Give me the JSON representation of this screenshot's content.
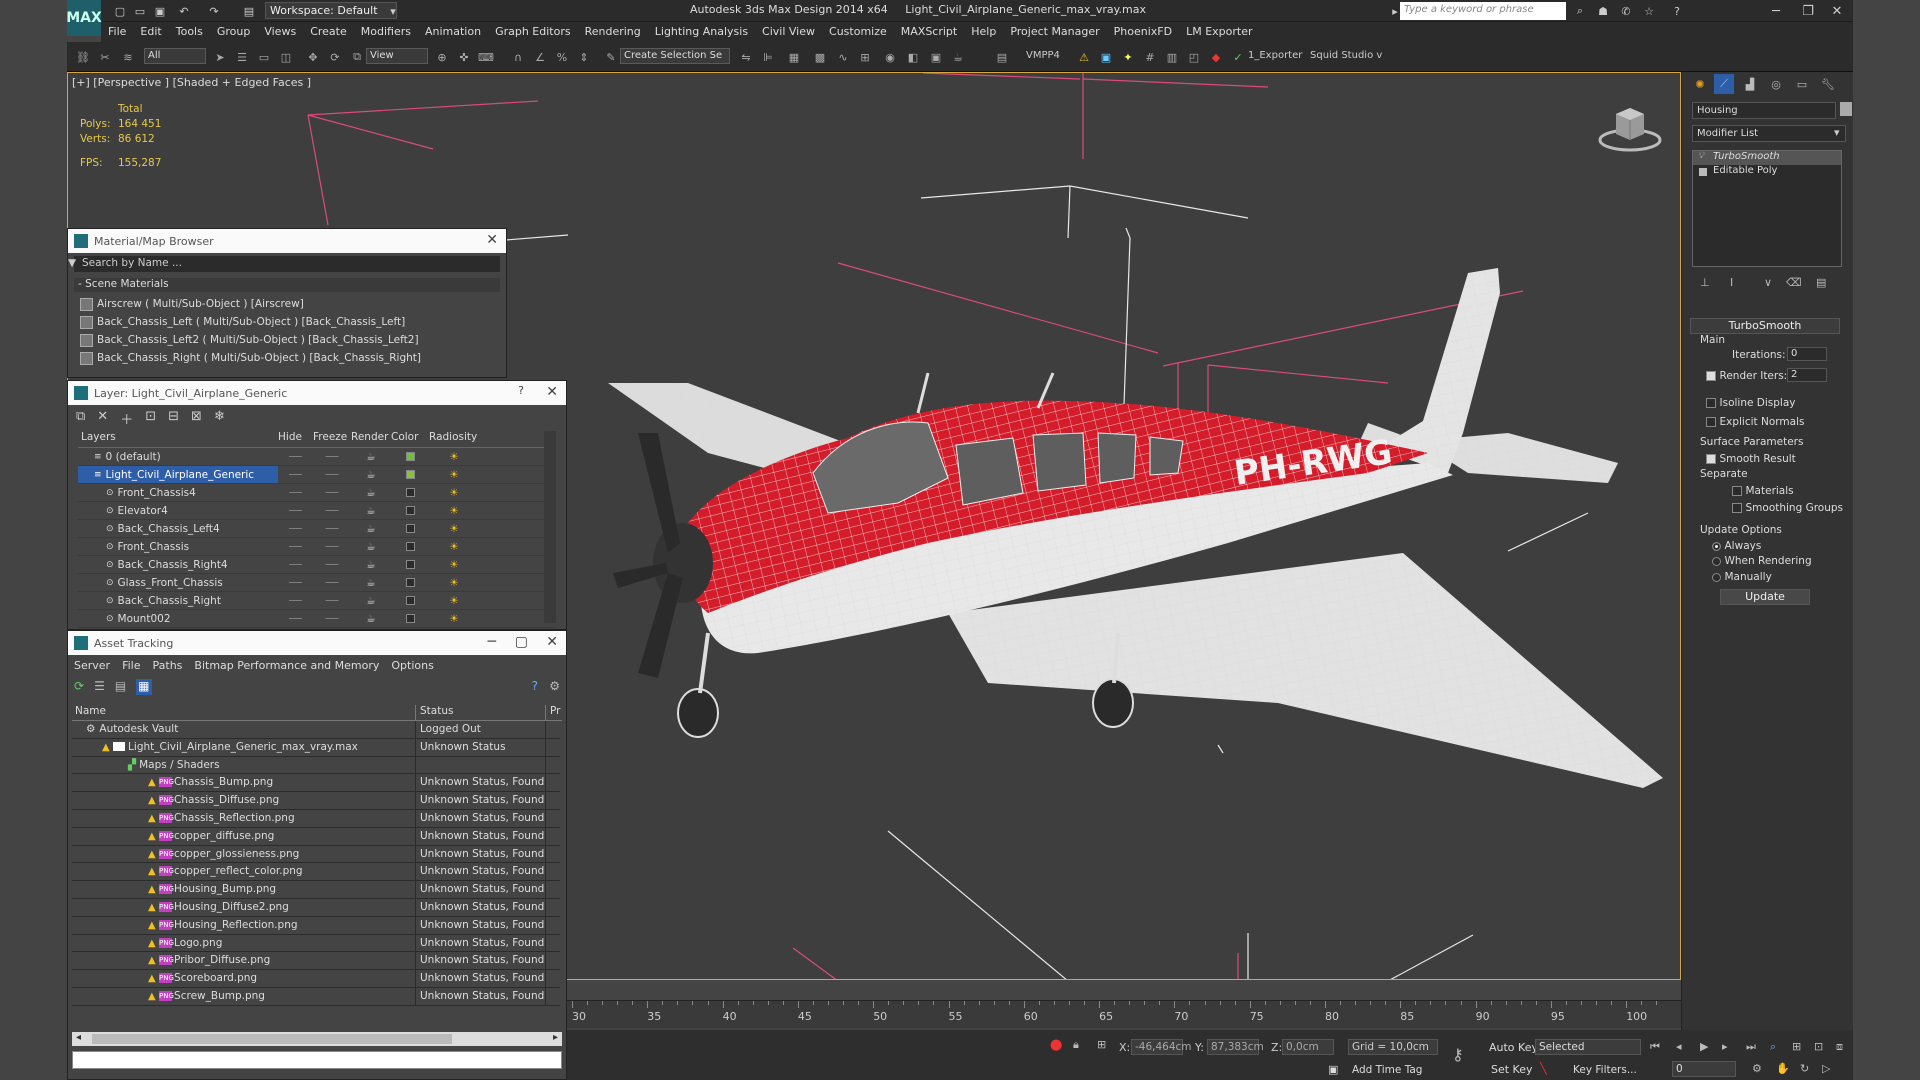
{
  "app": {
    "title": "Autodesk 3ds Max Design 2014 x64     Light_Civil_Airplane_Generic_max_vray.max",
    "logo_text": "MAX",
    "workspace": "Workspace: Default",
    "search_placeholder": "Type a keyword or phrase"
  },
  "menu": [
    "File",
    "Edit",
    "Tools",
    "Group",
    "Views",
    "Create",
    "Modifiers",
    "Animation",
    "Graph Editors",
    "Rendering",
    "Lighting Analysis",
    "Civil View",
    "Customize",
    "MAXScript",
    "Help",
    "Project Manager",
    "PhoenixFD",
    "LM Exporter"
  ],
  "toolbar": {
    "selection_filter": "All",
    "ref_coord": "View",
    "named_selection": "Create Selection Se",
    "vmpp": "VMPP4",
    "exporter": "1_Exporter",
    "squid": "Squid Studio v"
  },
  "viewport": {
    "label": "[+] [Perspective ] [Shaded + Edged Faces ]",
    "stats": {
      "total_label": "Total",
      "polys_label": "Polys:",
      "polys": "164 451",
      "verts_label": "Verts:",
      "verts": "86 612",
      "fps_label": "FPS:",
      "fps": "155,287"
    },
    "registration": "PH-RWG"
  },
  "material_browser": {
    "title": "Material/Map Browser",
    "search_placeholder": "Search by Name ...",
    "group": "- Scene Materials",
    "items": [
      "Airscrew  ( Multi/Sub-Object )  [Airscrew]",
      "Back_Chassis_Left  ( Multi/Sub-Object )  [Back_Chassis_Left]",
      "Back_Chassis_Left2  ( Multi/Sub-Object )  [Back_Chassis_Left2]",
      "Back_Chassis_Right  ( Multi/Sub-Object )  [Back_Chassis_Right]"
    ]
  },
  "layer_dialog": {
    "title": "Layer: Light_Civil_Airplane_Generic",
    "help": "?",
    "columns": [
      "Layers",
      "Hide",
      "Freeze",
      "Render",
      "Color",
      "Radiosity"
    ],
    "rows": [
      {
        "name": "0 (default)",
        "color": "#6fc040",
        "level": 1
      },
      {
        "name": "Light_Civil_Airplane_Generic",
        "color": "#88c040",
        "level": 1,
        "selected": true
      },
      {
        "name": "Front_Chassis4",
        "color": "#2b2b2b",
        "level": 2
      },
      {
        "name": "Elevator4",
        "color": "#2b2b2b",
        "level": 2
      },
      {
        "name": "Back_Chassis_Left4",
        "color": "#2b2b2b",
        "level": 2
      },
      {
        "name": "Front_Chassis",
        "color": "#2b2b2b",
        "level": 2
      },
      {
        "name": "Back_Chassis_Right4",
        "color": "#2b2b2b",
        "level": 2
      },
      {
        "name": "Glass_Front_Chassis",
        "color": "#2b2b2b",
        "level": 2
      },
      {
        "name": "Back_Chassis_Right",
        "color": "#2b2b2b",
        "level": 2
      },
      {
        "name": "Mount002",
        "color": "#2b2b2b",
        "level": 2
      }
    ]
  },
  "asset_tracking": {
    "title": "Asset Tracking",
    "menu": [
      "Server",
      "File",
      "Paths",
      "Bitmap Performance and Memory",
      "Options"
    ],
    "columns": [
      "Name",
      "Status",
      "Pr"
    ],
    "rows": [
      {
        "name": "Autodesk Vault",
        "status": "Logged Out",
        "indent": 0,
        "kind": "vault"
      },
      {
        "name": "Light_Civil_Airplane_Generic_max_vray.max",
        "status": "Unknown Status",
        "indent": 1,
        "kind": "max"
      },
      {
        "name": "Maps / Shaders",
        "status": "",
        "indent": 2,
        "kind": "folder"
      },
      {
        "name": "Chassis_Bump.png",
        "status": "Unknown Status, Found",
        "indent": 3,
        "kind": "png"
      },
      {
        "name": "Chassis_Diffuse.png",
        "status": "Unknown Status, Found",
        "indent": 3,
        "kind": "png"
      },
      {
        "name": "Chassis_Reflection.png",
        "status": "Unknown Status, Found",
        "indent": 3,
        "kind": "png"
      },
      {
        "name": "copper_diffuse.png",
        "status": "Unknown Status, Found",
        "indent": 3,
        "kind": "png"
      },
      {
        "name": "copper_glossieness.png",
        "status": "Unknown Status, Found",
        "indent": 3,
        "kind": "png"
      },
      {
        "name": "copper_reflect_color.png",
        "status": "Unknown Status, Found",
        "indent": 3,
        "kind": "png"
      },
      {
        "name": "Housing_Bump.png",
        "status": "Unknown Status, Found",
        "indent": 3,
        "kind": "png"
      },
      {
        "name": "Housing_Diffuse2.png",
        "status": "Unknown Status, Found",
        "indent": 3,
        "kind": "png"
      },
      {
        "name": "Housing_Reflection.png",
        "status": "Unknown Status, Found",
        "indent": 3,
        "kind": "png"
      },
      {
        "name": "Logo.png",
        "status": "Unknown Status, Found",
        "indent": 3,
        "kind": "png"
      },
      {
        "name": "Pribor_Diffuse.png",
        "status": "Unknown Status, Found",
        "indent": 3,
        "kind": "png"
      },
      {
        "name": "Scoreboard.png",
        "status": "Unknown Status, Found",
        "indent": 3,
        "kind": "png"
      },
      {
        "name": "Screw_Bump.png",
        "status": "Unknown Status, Found",
        "indent": 3,
        "kind": "png"
      }
    ]
  },
  "timeline": {
    "ticks": [
      "30",
      "35",
      "40",
      "45",
      "50",
      "55",
      "60",
      "65",
      "70",
      "75",
      "80",
      "85",
      "90",
      "95",
      "100"
    ]
  },
  "status": {
    "x_label": "X:",
    "x": "-46,464cm",
    "y_label": "Y:",
    "y": "87,383cm",
    "z_label": "Z:",
    "z": "0,0cm",
    "grid": "Grid = 10,0cm",
    "auto_key": "Auto Key",
    "set_key": "Set Key",
    "selected": "Selected",
    "key_filters": "Key Filters...",
    "add_time_tag": "Add Time Tag",
    "frame": "0"
  },
  "command_panel": {
    "object_name": "Housing",
    "modifier_list": "Modifier List",
    "stack": [
      "TurboSmooth",
      "Editable Poly"
    ],
    "rollout": "TurboSmooth",
    "main_label": "Main",
    "iterations_label": "Iterations:",
    "iterations": "0",
    "render_iters_label": "Render Iters:",
    "render_iters": "2",
    "isoline": "Isoline Display",
    "explicit": "Explicit Normals",
    "surface_params": "Surface Parameters",
    "smooth_result": "Smooth Result",
    "separate": "Separate",
    "materials": "Materials",
    "smoothing_groups": "Smoothing Groups",
    "update_options": "Update Options",
    "always": "Always",
    "when_rendering": "When Rendering",
    "manually": "Manually",
    "update": "Update"
  }
}
